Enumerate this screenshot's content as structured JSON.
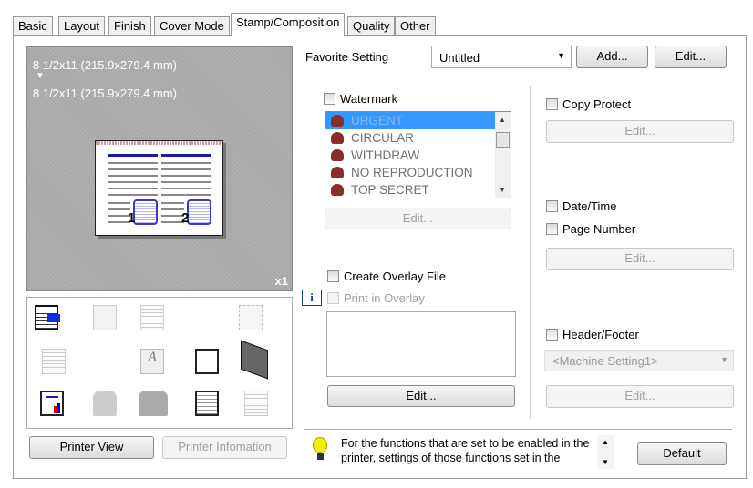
{
  "tabs": [
    "Basic",
    "Layout",
    "Finish",
    "Cover Mode",
    "Stamp/Composition",
    "Quality",
    "Other"
  ],
  "active_tab": "Stamp/Composition",
  "preview": {
    "paper_from": "8 1/2x11 (215.9x279.4 mm)",
    "arrow": "▼",
    "paper_to": "8 1/2x11 (215.9x279.4 mm)",
    "copies": "x1",
    "page1": "1",
    "page2": "2"
  },
  "left_buttons": {
    "printer_view": "Printer View",
    "printer_information": "Printer Infomation"
  },
  "favorite": {
    "label": "Favorite Setting",
    "value": "Untitled",
    "add": "Add...",
    "edit": "Edit..."
  },
  "watermark": {
    "label": "Watermark",
    "items": [
      "URGENT",
      "CIRCULAR",
      "WITHDRAW",
      "NO REPRODUCTION",
      "TOP SECRET"
    ],
    "selected": "URGENT",
    "edit": "Edit..."
  },
  "overlay": {
    "create_label": "Create Overlay File",
    "print_label": "Print in Overlay",
    "edit": "Edit...",
    "info_icon": "i"
  },
  "copy_protect": {
    "label": "Copy Protect",
    "edit": "Edit..."
  },
  "date_time": {
    "label": "Date/Time"
  },
  "page_number": {
    "label": "Page Number",
    "edit": "Edit..."
  },
  "header_footer": {
    "label": "Header/Footer",
    "value": "<Machine Setting1>",
    "edit": "Edit..."
  },
  "footer": {
    "message": "For the functions that are set to be enabled in the printer, settings of those functions set in the",
    "default": "Default"
  },
  "colors": {
    "selection": "#3399ff",
    "preview_bg": "#a8a8a8"
  }
}
